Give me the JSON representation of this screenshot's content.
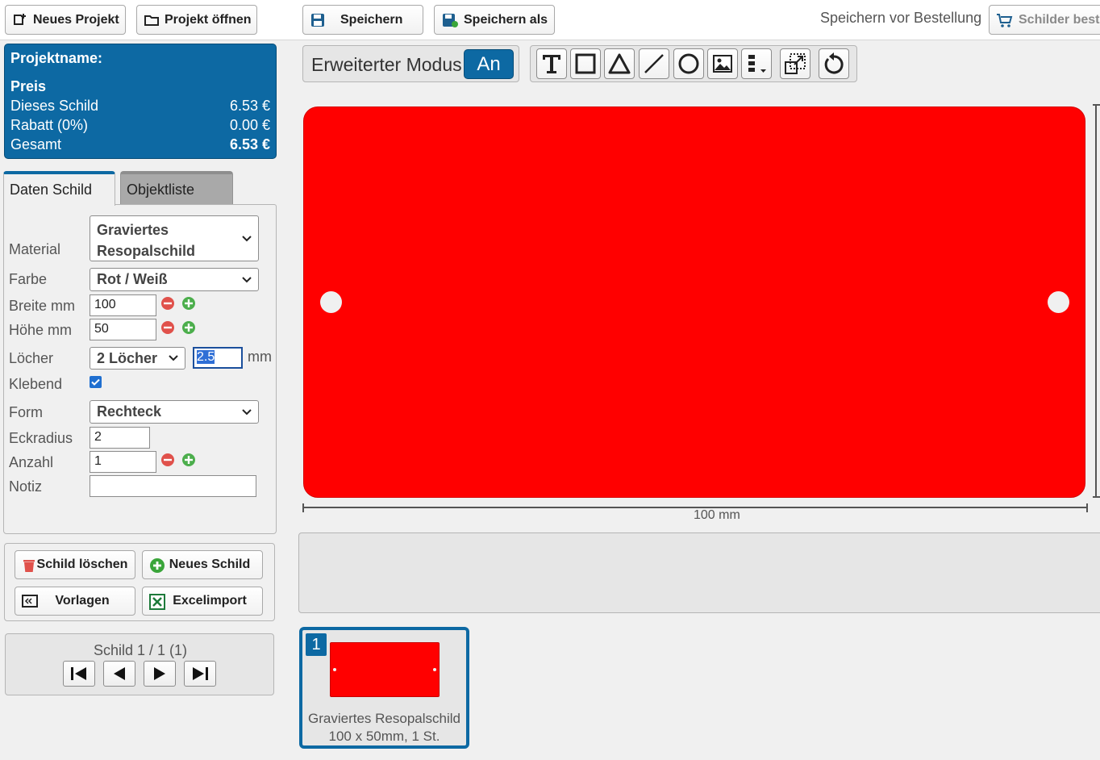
{
  "toolbar": {
    "new_project": "Neues Projekt",
    "open_project": "Projekt öffnen",
    "save": "Speichern",
    "save_as": "Speichern als",
    "save_note": "Speichern vor Bestellung",
    "order": "Schilder beste"
  },
  "price": {
    "project_label": "Projektname:",
    "heading": "Preis",
    "rows": [
      {
        "label": "Dieses Schild",
        "value": "6.53 €"
      },
      {
        "label": "Rabatt (0%)",
        "value": "0.00 €"
      }
    ],
    "total_label": "Gesamt",
    "total_value": "6.53 €"
  },
  "tabs": {
    "active": "Daten Schild",
    "inactive": "Objektliste"
  },
  "form": {
    "material_label": "Material",
    "material_line1": "Graviertes",
    "material_line2": "Resopalschild",
    "color_label": "Farbe",
    "color_value": "Rot / Weiß",
    "width_label": "Breite mm",
    "width_value": "100",
    "height_label": "Höhe mm",
    "height_value": "50",
    "holes_label": "Löcher",
    "holes_value": "2 Löcher",
    "hole_size": "2.5",
    "hole_unit": "mm",
    "adhesive_label": "Klebend",
    "adhesive_checked": true,
    "shape_label": "Form",
    "shape_value": "Rechteck",
    "radius_label": "Eckradius",
    "radius_value": "2",
    "count_label": "Anzahl",
    "count_value": "1",
    "note_label": "Notiz",
    "note_value": ""
  },
  "actions": {
    "delete": "Schild löschen",
    "new_sign": "Neues Schild",
    "templates": "Vorlagen",
    "excel": "Excelimport"
  },
  "nav": {
    "status": "Schild 1 / 1 (1)"
  },
  "editor": {
    "mode_label": "Erweiterter Modus",
    "mode_value": "An",
    "sign_color": "#ff0000",
    "width_dimension": "100 mm"
  },
  "thumbnail": {
    "number": "1",
    "caption_line1": "Graviertes Resopalschild",
    "caption_line2": "100 x 50mm, 1 St."
  }
}
